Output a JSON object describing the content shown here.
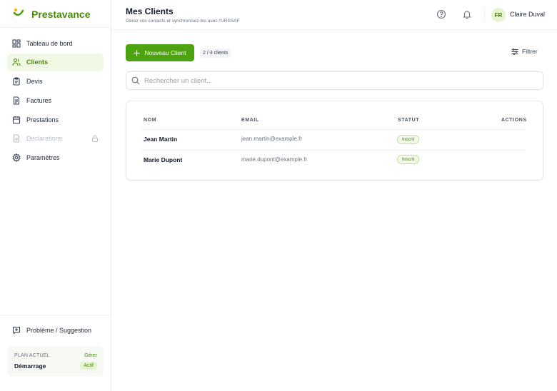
{
  "brand": {
    "name": "Prestavance",
    "accent": "#4ea310"
  },
  "sidebar": {
    "items": [
      {
        "label": "Tableau de bord",
        "icon": "dashboard-icon",
        "state": "normal"
      },
      {
        "label": "Clients",
        "icon": "users-icon",
        "state": "active"
      },
      {
        "label": "Devis",
        "icon": "clipboard-icon",
        "state": "normal"
      },
      {
        "label": "Factures",
        "icon": "document-icon",
        "state": "normal"
      },
      {
        "label": "Prestations",
        "icon": "calendar-icon",
        "state": "normal"
      },
      {
        "label": "Déclarations",
        "icon": "file-icon",
        "state": "disabled"
      },
      {
        "label": "Paramètres",
        "icon": "gear-icon",
        "state": "normal"
      }
    ],
    "report_label": "Problème / Suggestion",
    "plan": {
      "label": "PLAN ACTUEL",
      "name": "Démarrage",
      "manage": "Gérer",
      "badge": "Actif"
    }
  },
  "header": {
    "title": "Mes Clients",
    "subtitle": "Gérez vos contacts et synchronisez-les avec l'URSSAF",
    "language": "FR",
    "user_name": "Claire Duval"
  },
  "toolbar": {
    "new_client_label": "Nouveau Client",
    "count": "2 / 3 clients",
    "filter_label": "Filtrer"
  },
  "search": {
    "placeholder": "Rechercher un client...",
    "value": ""
  },
  "table": {
    "headers": {
      "name": "NOM",
      "email": "EMAIL",
      "status": "STATUT",
      "actions": "ACTIONS"
    },
    "rows": [
      {
        "name": "Jean Martin",
        "email": "jean.martin@example.fr",
        "status": "Inscrit"
      },
      {
        "name": "Marie Dupont",
        "email": "marie.dupont@example.fr",
        "status": "Inscrit"
      }
    ]
  }
}
